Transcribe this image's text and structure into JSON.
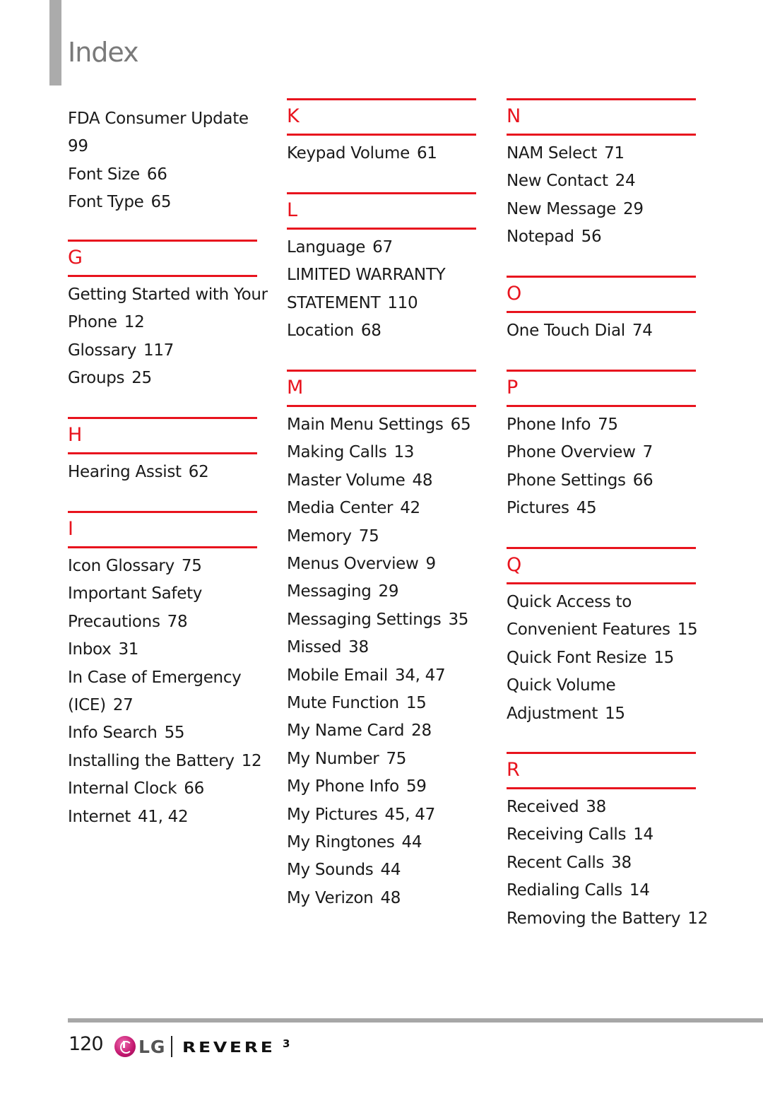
{
  "page": {
    "title": "Index",
    "page_number": "120"
  },
  "footer": {
    "brand_lg": "LG",
    "brand_product": "REVERE",
    "brand_suffix": "3"
  },
  "colors": {
    "accent": "#e8141e",
    "title_gray": "#7a7a7a",
    "bar_gray": "#ababab"
  },
  "columns": [
    {
      "blocks": [
        {
          "letter": null,
          "entries": [
            {
              "text": "FDA Consumer Update",
              "page": ""
            },
            {
              "text": "99",
              "page": ""
            },
            {
              "text": "Font Size",
              "page": "66"
            },
            {
              "text": "Font Type",
              "page": "65"
            }
          ]
        },
        {
          "letter": "G",
          "entries": [
            {
              "text": "Getting Started with Your",
              "page": ""
            },
            {
              "text": "Phone",
              "page": "12"
            },
            {
              "text": "Glossary",
              "page": "117"
            },
            {
              "text": "Groups",
              "page": "25"
            }
          ]
        },
        {
          "letter": "H",
          "entries": [
            {
              "text": "Hearing Assist",
              "page": "62"
            }
          ]
        },
        {
          "letter": "I",
          "entries": [
            {
              "text": "Icon Glossary",
              "page": "75"
            },
            {
              "text": "Important Safety",
              "page": ""
            },
            {
              "text": "Precautions",
              "page": "78"
            },
            {
              "text": "Inbox",
              "page": "31"
            },
            {
              "text": "In Case of Emergency",
              "page": ""
            },
            {
              "text": "(ICE)",
              "page": "27"
            },
            {
              "text": "Info Search",
              "page": "55"
            },
            {
              "text": "Installing the Battery",
              "page": "12"
            },
            {
              "text": "Internal Clock",
              "page": "66"
            },
            {
              "text": "Internet",
              "page": "41, 42"
            }
          ]
        }
      ]
    },
    {
      "blocks": [
        {
          "letter": "K",
          "entries": [
            {
              "text": "Keypad Volume",
              "page": "61"
            }
          ]
        },
        {
          "letter": "L",
          "entries": [
            {
              "text": "Language",
              "page": "67"
            },
            {
              "text": "LIMITED WARRANTY",
              "page": ""
            },
            {
              "text": "STATEMENT",
              "page": "110"
            },
            {
              "text": "Location",
              "page": "68"
            }
          ]
        },
        {
          "letter": "M",
          "entries": [
            {
              "text": "Main Menu Settings",
              "page": "65"
            },
            {
              "text": "Making Calls",
              "page": "13"
            },
            {
              "text": "Master Volume",
              "page": "48"
            },
            {
              "text": "Media Center",
              "page": "42"
            },
            {
              "text": "Memory",
              "page": "75"
            },
            {
              "text": "Menus Overview",
              "page": "9"
            },
            {
              "text": "Messaging",
              "page": "29"
            },
            {
              "text": "Messaging Settings",
              "page": "35"
            },
            {
              "text": "Missed",
              "page": "38"
            },
            {
              "text": "Mobile Email",
              "page": "34, 47"
            },
            {
              "text": "Mute Function",
              "page": "15"
            },
            {
              "text": "My Name Card",
              "page": "28"
            },
            {
              "text": "My Number",
              "page": "75"
            },
            {
              "text": "My Phone Info",
              "page": "59"
            },
            {
              "text": "My Pictures",
              "page": "45, 47"
            },
            {
              "text": "My Ringtones",
              "page": "44"
            },
            {
              "text": "My Sounds",
              "page": "44"
            },
            {
              "text": "My Verizon",
              "page": "48"
            }
          ]
        }
      ]
    },
    {
      "blocks": [
        {
          "letter": "N",
          "entries": [
            {
              "text": "NAM Select",
              "page": "71"
            },
            {
              "text": "New Contact",
              "page": "24"
            },
            {
              "text": "New Message",
              "page": "29"
            },
            {
              "text": "Notepad",
              "page": "56"
            }
          ]
        },
        {
          "letter": "O",
          "entries": [
            {
              "text": "One Touch Dial",
              "page": "74"
            }
          ]
        },
        {
          "letter": "P",
          "entries": [
            {
              "text": "Phone Info",
              "page": "75"
            },
            {
              "text": "Phone Overview",
              "page": "7"
            },
            {
              "text": "Phone Settings",
              "page": "66"
            },
            {
              "text": "Pictures",
              "page": "45"
            }
          ]
        },
        {
          "letter": "Q",
          "entries": [
            {
              "text": "Quick Access to",
              "page": ""
            },
            {
              "text": "Convenient Features",
              "page": "15"
            },
            {
              "text": "Quick Font Resize",
              "page": "15"
            },
            {
              "text": "Quick Volume",
              "page": ""
            },
            {
              "text": "Adjustment",
              "page": "15"
            }
          ]
        },
        {
          "letter": "R",
          "entries": [
            {
              "text": "Received",
              "page": "38"
            },
            {
              "text": "Receiving Calls",
              "page": "14"
            },
            {
              "text": "Recent Calls",
              "page": "38"
            },
            {
              "text": "Redialing Calls",
              "page": "14"
            },
            {
              "text": "Removing the Battery",
              "page": "12"
            }
          ]
        }
      ]
    }
  ]
}
